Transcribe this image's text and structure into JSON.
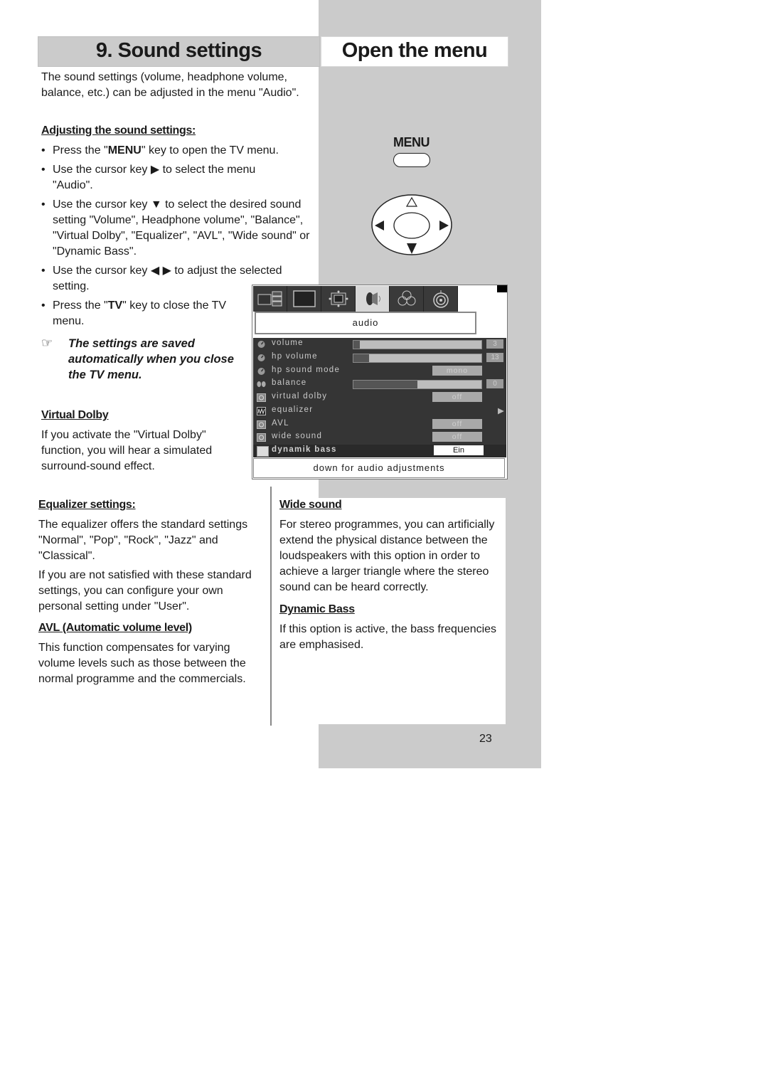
{
  "header": {
    "section_title": "9. Sound settings",
    "side_title": "Open the menu"
  },
  "intro": "The sound settings (volume, headphone volume, balance, etc.) can be adjusted in the menu \"Audio\".",
  "adjusting": {
    "heading": "Adjusting the sound settings:",
    "steps": [
      {
        "pre": "Press the \"",
        "key": "MENU",
        "post": "\" key to open the TV menu."
      },
      {
        "pre": "Use the cursor key ▶ to select the menu \"Audio\".",
        "key": "",
        "post": ""
      },
      {
        "pre": "Use the cursor key ▼ to select the desired sound setting \"Volume\", Headphone volume\", \"Balance\", \"Virtual Dolby\", \"Equalizer\", \"AVL\", \"Wide sound\" or \"Dynamic Bass\".",
        "key": "",
        "post": ""
      },
      {
        "pre": "Use the cursor key ◀ ▶ to adjust the selected setting.",
        "key": "",
        "post": ""
      },
      {
        "pre": "Press the \"",
        "key": "TV",
        "post": "\" key to close the TV menu."
      }
    ],
    "note_icon": "pointing-hand-icon",
    "note": "The settings are saved automatically when you close the TV menu."
  },
  "virtual_dolby": {
    "heading": "Virtual Dolby",
    "body": "If you activate the \"Virtual Dolby\" function, you will hear a simulated surround-sound effect."
  },
  "remote": {
    "menu_label": "MENU",
    "dpad_up": "△",
    "dpad_left": "◀",
    "dpad_right": "▶",
    "dpad_down": "▼"
  },
  "tv_menu": {
    "tabs": [
      "picture-in-picture-icon",
      "screen-icon",
      "geometry-icon",
      "audio-speaker-icon",
      "colour-circles-icon",
      "signal-icon"
    ],
    "active_tab": 3,
    "title": "audio",
    "rows": [
      {
        "label": "volume",
        "icon": "dial-icon",
        "type": "bar",
        "level": 0.05,
        "value": "3"
      },
      {
        "label": "hp volume",
        "icon": "dial-icon",
        "type": "bar",
        "level": 0.12,
        "value": "13"
      },
      {
        "label": "hp sound mode",
        "icon": "dial-icon",
        "type": "chip",
        "value": "mono"
      },
      {
        "label": "balance",
        "icon": "balance-icon",
        "type": "bar",
        "level": 0.5,
        "value": "0"
      },
      {
        "label": "virtual dolby",
        "icon": "dolby-icon",
        "type": "chip",
        "value": "off"
      },
      {
        "label": "equalizer",
        "icon": "equalizer-icon",
        "type": "arrow",
        "value": "▶"
      },
      {
        "label": "AVL",
        "icon": "avl-icon",
        "type": "chip",
        "value": "off"
      },
      {
        "label": "wide sound",
        "icon": "wide-sound-icon",
        "type": "chip",
        "value": "off"
      },
      {
        "label": "dynamik bass",
        "icon": "bass-icon",
        "type": "selected",
        "value": "Ein"
      }
    ],
    "hint": "down for audio adjustments"
  },
  "equalizer": {
    "heading": "Equalizer settings:",
    "body1": "The equalizer offers the standard settings \"Normal\", \"Pop\", \"Rock\", \"Jazz\" and \"Classical\".",
    "body2": "If you are not satisfied with these standard settings, you can configure your own personal setting under \"User\"."
  },
  "avl": {
    "heading": "AVL (Automatic volume level)",
    "body": "This function compensates for varying volume levels such as those between the normal programme and the commercials."
  },
  "wide_sound": {
    "heading": "Wide sound",
    "body": "For stereo programmes, you can artificially extend the physical distance between the loudspeakers with this option in order to achieve a larger triangle where the stereo sound can be heard correctly."
  },
  "dynamic_bass": {
    "heading": "Dynamic Bass",
    "body": "If this option is active, the bass frequencies are emphasised."
  },
  "page_number": "23"
}
